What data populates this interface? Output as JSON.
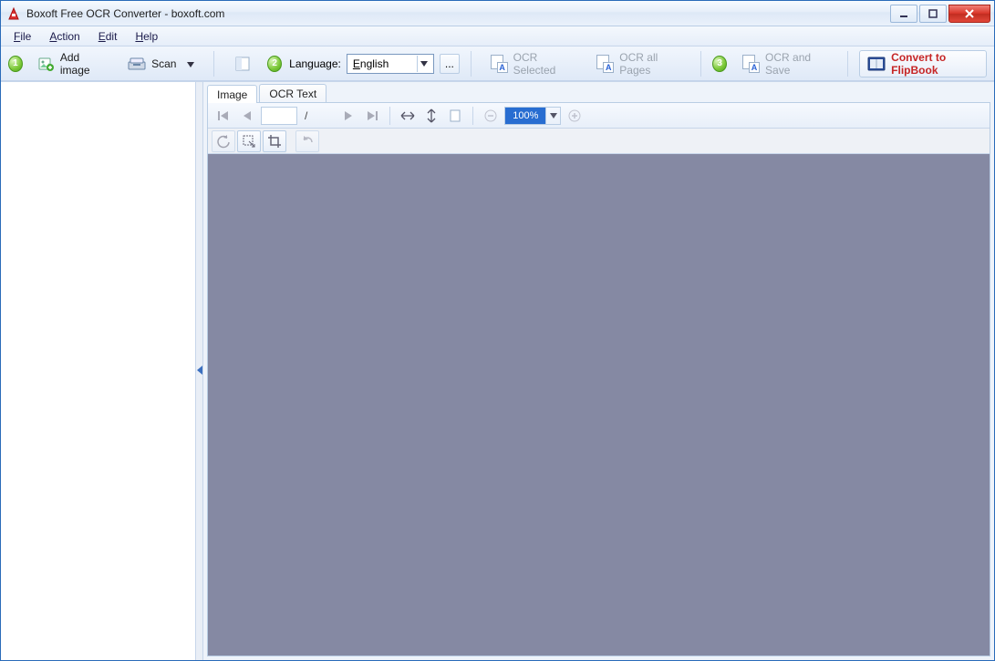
{
  "window": {
    "title": "Boxoft Free OCR Converter - boxoft.com"
  },
  "menubar": {
    "file": "File",
    "action": "Action",
    "edit": "Edit",
    "help": "Help"
  },
  "toolbar": {
    "step1": "1",
    "add_image": "Add image",
    "scan": "Scan",
    "step2": "2",
    "language_label": "Language:",
    "language_value": "English",
    "ellipsis": "...",
    "ocr_selected": "OCR Selected",
    "ocr_all_pages": "OCR all Pages",
    "step3": "3",
    "ocr_and_save": "OCR and Save",
    "convert_flipbook": "Convert to FlipBook"
  },
  "tabs": {
    "image": "Image",
    "ocr_text": "OCR Text"
  },
  "nav": {
    "page_value": "",
    "slash": "/",
    "zoom_value": "100%"
  }
}
